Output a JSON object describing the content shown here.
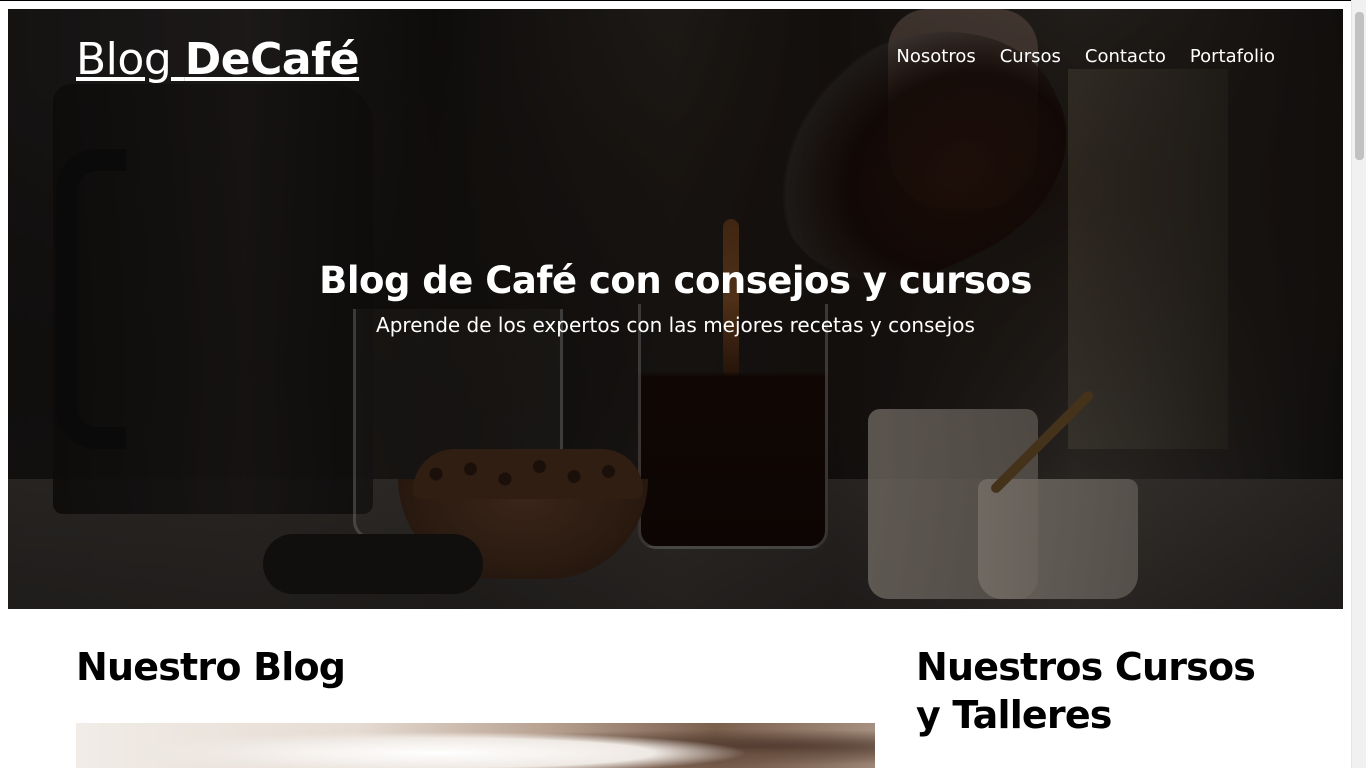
{
  "header": {
    "logo_light": "Blog ",
    "logo_bold": "DeCafé",
    "nav": [
      {
        "label": "Nosotros"
      },
      {
        "label": "Cursos"
      },
      {
        "label": "Contacto"
      },
      {
        "label": "Portafolio"
      }
    ]
  },
  "hero": {
    "title": "Blog de Café con consejos y cursos",
    "subtitle": "Aprende de los expertos con las mejores recetas y consejos"
  },
  "main": {
    "blog_title": "Nuestro Blog",
    "courses_title": "Nuestros Cursos y Talleres"
  },
  "colors": {
    "text_dark": "#000000",
    "text_light": "#ffffff",
    "overlay": "#000000"
  }
}
